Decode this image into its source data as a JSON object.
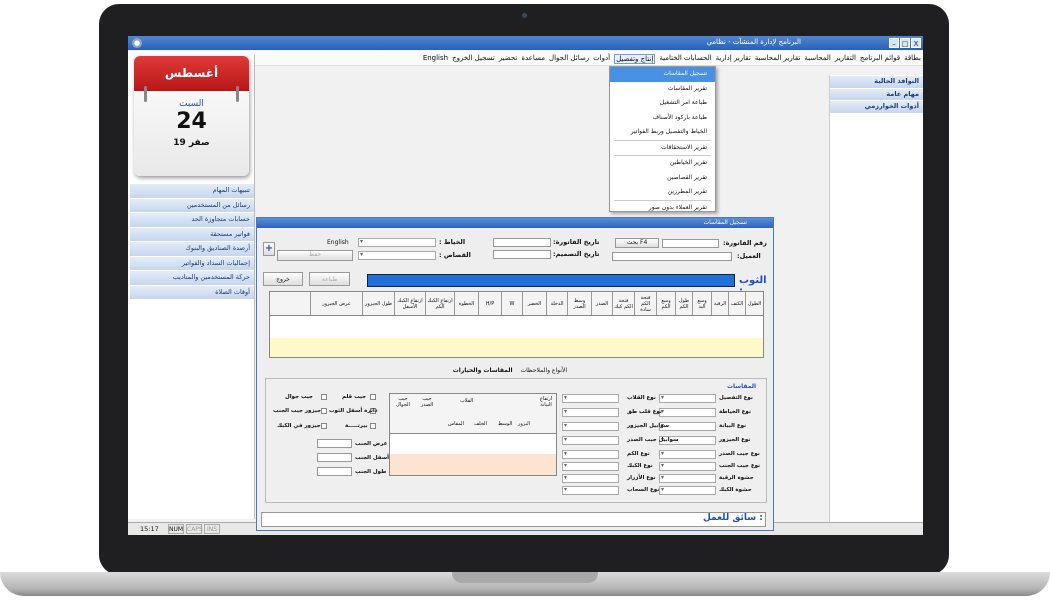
{
  "window": {
    "title": "البرنامج لإدارة المنشآت - نظامي",
    "buttons": [
      "–",
      "□",
      "X"
    ]
  },
  "menu": [
    "بطاقة",
    "قوائم البرنامج",
    "التقارير",
    "المحاسبة",
    "تقارير المحاسبة",
    "تقارير إدارية",
    "الحسابات الختامية",
    "إنتاج وتفصيل",
    "أدوات",
    "رسائل الجوال",
    "مساعدة",
    "تحضير",
    "تسجيل الخروج",
    "English"
  ],
  "dropdown": {
    "items": [
      "تسجيل المقاسات",
      "تقرير المقاسات",
      "طباعة امر التشغيل",
      "طباعة باركود الأصناف",
      "الخياط والتفصيل وربط الفواتير",
      "تقرير الاستحقاقات",
      "تقرير الخياطين",
      "تقرير القصاصين",
      "تقرير المطرزين",
      "تقرير العملاء بدون صور"
    ]
  },
  "calendar": {
    "month": "أغسطس",
    "weekday": "السبت",
    "day": "24",
    "hijri": "19 صفر"
  },
  "left_panel": [
    "تنبيهات المهام",
    "رسائل من المستخدمين",
    "حسابات متجاوزة الحد",
    "فواتير مستحقة",
    "أرصدة الصناديق والبنوك",
    "إجماليات السداد والفواتير",
    "حركة المستخدمين والمناديب",
    "أوقات الصلاة"
  ],
  "right_panel": [
    "النوافذ الحالية",
    "مهام عامة",
    "أدوات الخوارزمي"
  ],
  "status": {
    "time": "15:17",
    "keys": [
      "NUM",
      "CAPS",
      "INS"
    ]
  },
  "form": {
    "title": "تسجيل المقاسات",
    "invoice_no": "رقم الفاتورة:",
    "customer": "العميل:",
    "invoice_date": "تاريخ الفاتورة:",
    "design_date": "تاريخ التصميم:",
    "tailor": "الخياط :",
    "cutter": "القصاص :",
    "search_btn": "بحث F4",
    "english": "English",
    "print_btn": "طباعة",
    "exit_btn": "خروج",
    "save_btn": "حفظ",
    "plus": "+",
    "thobe": "الثوب :",
    "columns": [
      "الطول",
      "الكتف",
      "الرقبة",
      "وسع اليد",
      "طول الكم",
      "وسع الكم",
      "فتحة الكم سادة",
      "فتحة الكم كبك",
      "الصدر",
      "وسط الصدر",
      "الدخلة",
      "الخصر",
      "W",
      "H/P",
      "الخطوة",
      "ارتفاع الكبك الكم",
      "ارتفاع الكبك الأسفل",
      "طول الجيزور",
      "عرض الجيزور"
    ],
    "tabs": [
      "الأنواع والملاحظات",
      "المقاسات والخيارات"
    ],
    "section": "المقاسات",
    "right_labels": [
      "نوع التفصيل",
      "نوع الخياطة",
      "نوع البيانة",
      "نوع الجيزور",
      "نوع جيب الصدر",
      "نوع جيب الجنب",
      "حشوة الرقبة",
      "حشوة الكبك"
    ],
    "mid_labels": [
      "نوع القلاب",
      "نوع قلب طق",
      "سوابيل الجيزور",
      "سوابيل جيب الصدر",
      "نوع الكم",
      "نوع الكبك",
      "نوع الأزرار",
      "نوع السحاب"
    ],
    "grid2_headers": [
      "ارتفاع البيانة",
      "القلاب",
      "جيب الصدر",
      "جيب الجوال"
    ],
    "grid2_sub": [
      "البزور",
      "الوسط",
      "الخلف",
      "المقاس"
    ],
    "checks": [
      "جيب جوال",
      "جيب قلم",
      "جيزور جيب الجنب",
      "دائرة أسفل الثوب",
      "جيزور في الكبك",
      "بيرتـــــة"
    ],
    "size_labels": [
      "عرض الجنب",
      "أسفل الجنب",
      "طول الجنب"
    ],
    "bottom_label": "سائق للعمل :"
  }
}
